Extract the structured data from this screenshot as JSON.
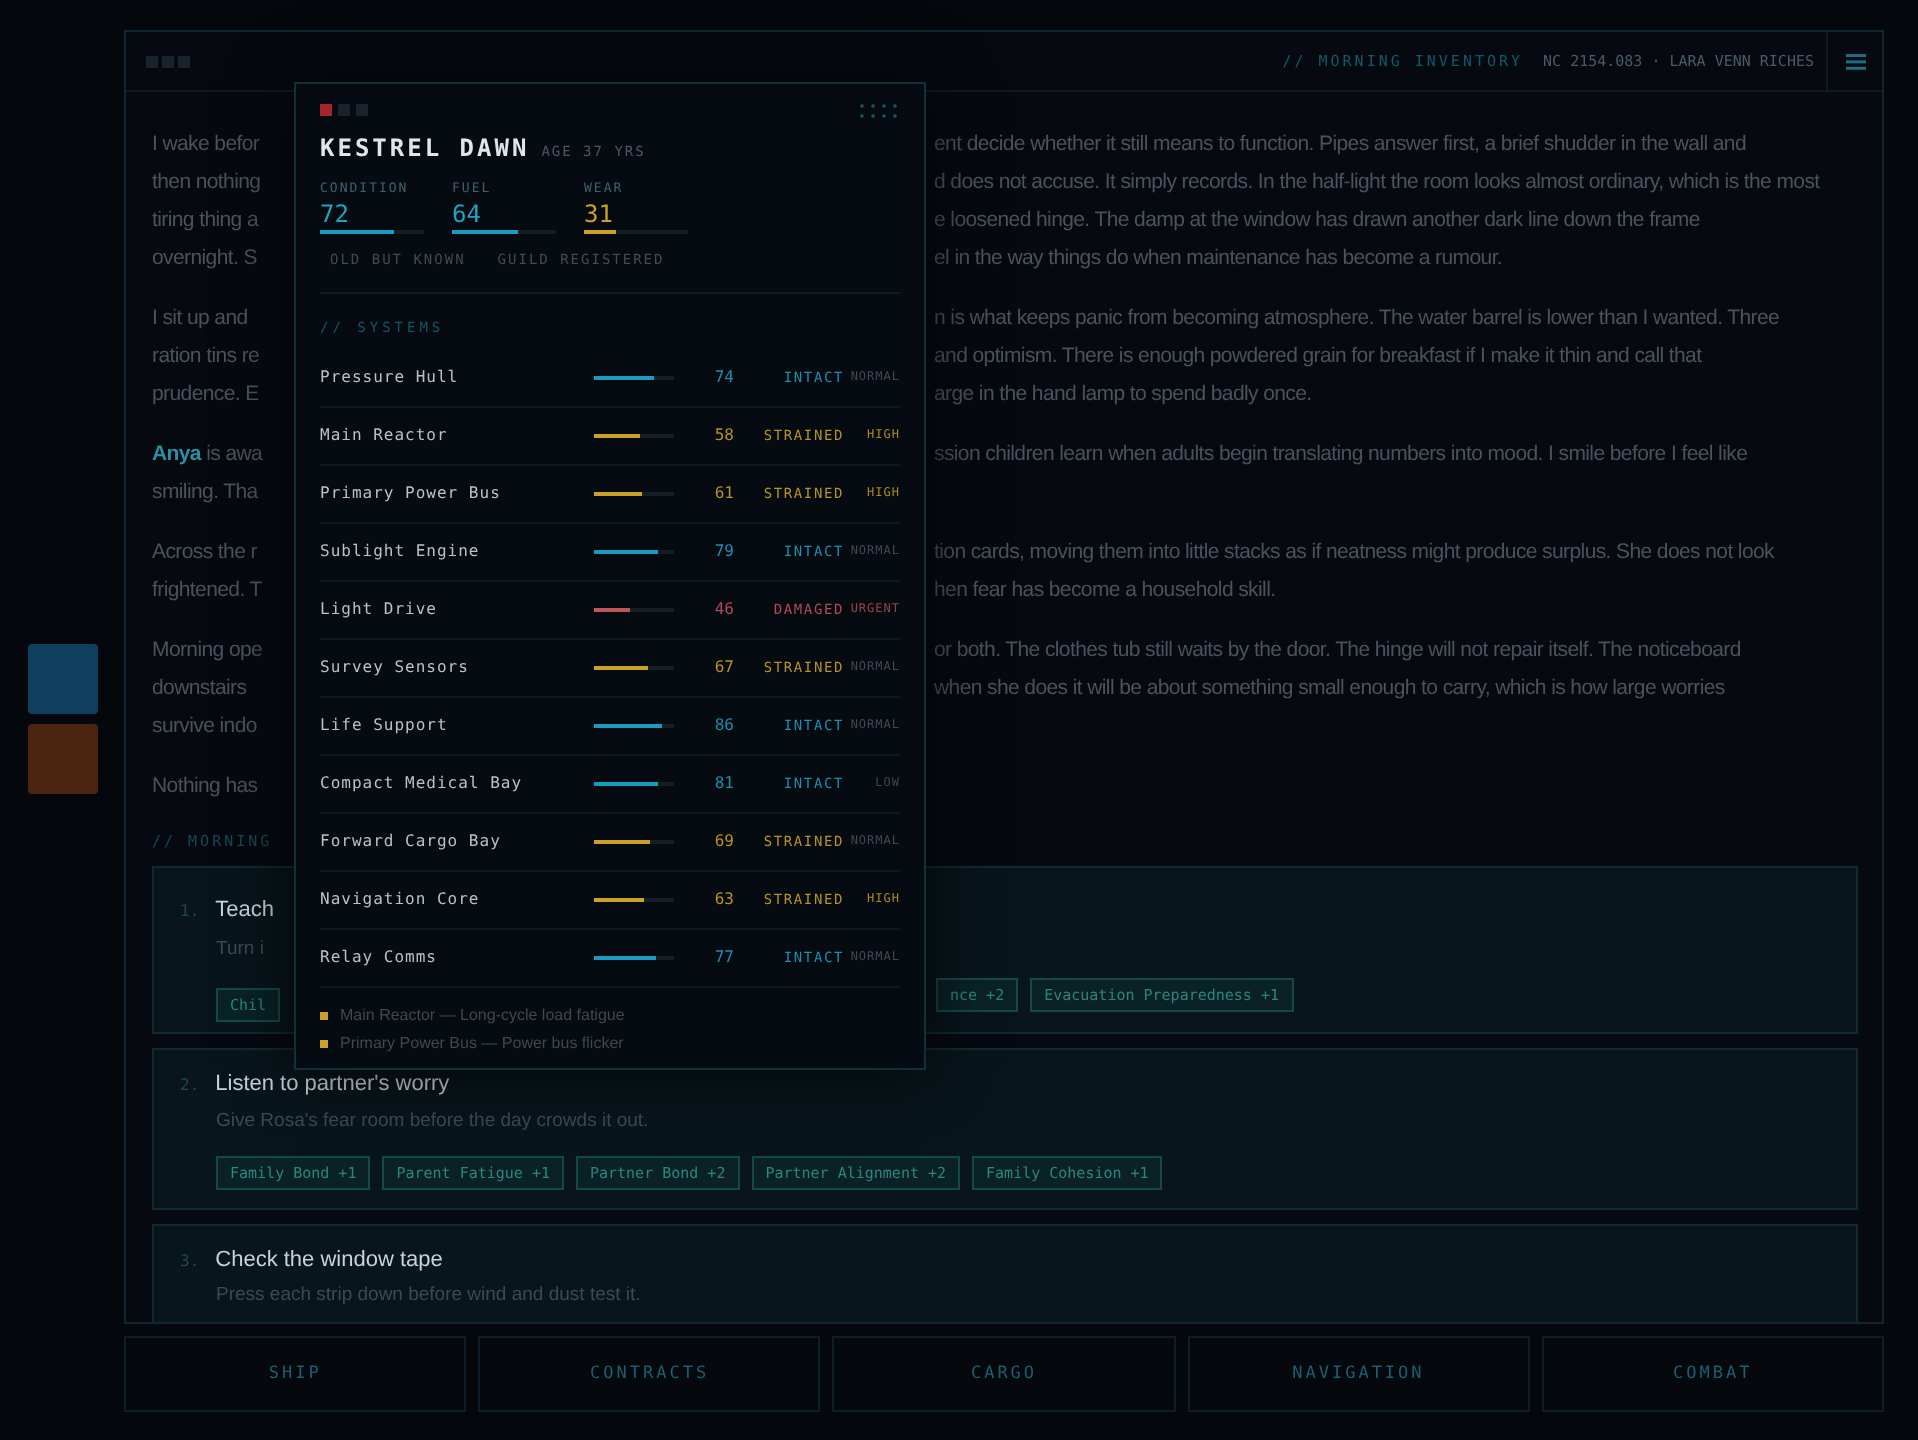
{
  "header": {
    "section": "// MORNING INVENTORY",
    "meta": "NC 2154.083 · LARA VENN RICHES"
  },
  "paragraphs": [
    {
      "lines": [
        {
          "left": "I wake befor",
          "right": "ent decide whether it still means to function. Pipes answer first, a brief shudder in the wall and"
        },
        {
          "left": "then nothing",
          "right": "d does not accuse. It simply records. In the half-light the room looks almost ordinary, which is the most"
        },
        {
          "left": "tiring thing a",
          "right": "e loosened hinge. The damp at the window has drawn another dark line down the frame"
        },
        {
          "left": "overnight. S",
          "right": "el in the way things do when maintenance has become a rumour."
        }
      ]
    },
    {
      "lines": [
        {
          "left": "I sit up and",
          "right": "n is what keeps panic from becoming atmosphere. The water barrel is lower than I wanted. Three"
        },
        {
          "left": "ration tins re",
          "right": "and optimism. There is enough powdered grain for breakfast if I make it thin and call that"
        },
        {
          "left": "prudence. E",
          "right": "arge in the hand lamp to spend badly once."
        }
      ]
    },
    {
      "lines": [
        {
          "highlight": "Anya",
          "left": " is awa",
          "right": "ssion children learn when adults begin translating numbers into mood. I smile before I feel like"
        },
        {
          "left": "smiling. Tha"
        }
      ]
    },
    {
      "lines": [
        {
          "left": "Across the r",
          "right": "tion cards, moving them into little stacks as if neatness might produce surplus. She does not look"
        },
        {
          "left": "frightened. T",
          "right": "hen fear has become a household skill."
        }
      ]
    },
    {
      "lines": [
        {
          "left": "Morning ope",
          "right": "or both. The clothes tub still waits by the door. The hinge will not repair itself. The noticeboard"
        },
        {
          "left": "downstairs",
          "right": "when she does it will be about something small enough to carry, which is how large worries"
        },
        {
          "left": "survive indo"
        }
      ]
    },
    {
      "lines": [
        {
          "left": "Nothing has"
        }
      ]
    }
  ],
  "section_label": "// MORNING",
  "tasks": [
    {
      "kind": "covered",
      "number": "1.",
      "title": "Teach",
      "subtitle": "Turn i",
      "tags_left": [
        "Chil"
      ],
      "tags": [
        "nce +2",
        "Evacuation Preparedness +1"
      ]
    },
    {
      "kind": "full",
      "number": "2.",
      "title": "Listen to partner's worry",
      "subtitle": "Give Rosa's fear room before the day crowds it out.",
      "tags": [
        "Family Bond +1",
        "Parent Fatigue +1",
        "Partner Bond +2",
        "Partner Alignment +2",
        "Family Cohesion +1"
      ]
    },
    {
      "kind": "full",
      "number": "3.",
      "title": "Check the window tape",
      "subtitle": "Press each strip down before wind and dust test it."
    }
  ],
  "nav": [
    "SHIP",
    "CONTRACTS",
    "CARGO",
    "NAVIGATION",
    "COMBAT"
  ],
  "ship": {
    "name": "KESTREL DAWN",
    "age": "AGE 37 YRS",
    "stats": [
      {
        "label": "CONDITION",
        "value": "72",
        "level": 0.72,
        "kind": "nominal"
      },
      {
        "label": "FUEL",
        "value": "64",
        "level": 0.64,
        "kind": "nominal"
      },
      {
        "label": "WEAR",
        "value": "31",
        "level": 0.31,
        "kind": "warning"
      }
    ],
    "tags": [
      "OLD BUT KNOWN",
      "GUILD REGISTERED"
    ],
    "systems_label": "// SYSTEMS",
    "systems": [
      {
        "name": "Pressure Hull",
        "level": 0.74,
        "value": "74",
        "status": "INTACT",
        "kind": "intact",
        "priority": {
          "label": "NORMAL",
          "color": "#3e4a55"
        }
      },
      {
        "name": "Main Reactor",
        "level": 0.58,
        "value": "58",
        "status": "STRAINED",
        "kind": "strained",
        "priority": {
          "label": "HIGH",
          "color": "#a88a25"
        }
      },
      {
        "name": "Primary Power Bus",
        "level": 0.61,
        "value": "61",
        "status": "STRAINED",
        "kind": "strained",
        "priority": {
          "label": "HIGH",
          "color": "#a88a25"
        }
      },
      {
        "name": "Sublight Engine",
        "level": 0.79,
        "value": "79",
        "status": "INTACT",
        "kind": "intact",
        "priority": {
          "label": "NORMAL",
          "color": "#3e4a55"
        }
      },
      {
        "name": "Light Drive",
        "level": 0.46,
        "value": "46",
        "status": "DAMAGED",
        "kind": "damaged",
        "priority": {
          "label": "URGENT",
          "color": "#a0404a"
        }
      },
      {
        "name": "Survey Sensors",
        "level": 0.67,
        "value": "67",
        "status": "STRAINED",
        "kind": "strained",
        "priority": {
          "label": "NORMAL",
          "color": "#3e4a55"
        }
      },
      {
        "name": "Life Support",
        "level": 0.86,
        "value": "86",
        "status": "INTACT",
        "kind": "intact",
        "priority": {
          "label": "NORMAL",
          "color": "#3e4a55"
        }
      },
      {
        "name": "Compact Medical Bay",
        "level": 0.81,
        "value": "81",
        "status": "INTACT",
        "kind": "intact",
        "priority": {
          "label": "LOW",
          "color": "#3a4650"
        }
      },
      {
        "name": "Forward Cargo Bay",
        "level": 0.69,
        "value": "69",
        "status": "STRAINED",
        "kind": "strained",
        "priority": {
          "label": "NORMAL",
          "color": "#3e4a55"
        }
      },
      {
        "name": "Navigation Core",
        "level": 0.63,
        "value": "63",
        "status": "STRAINED",
        "kind": "strained",
        "priority": {
          "label": "HIGH",
          "color": "#a88a25"
        }
      },
      {
        "name": "Relay Comms",
        "level": 0.77,
        "value": "77",
        "status": "INTACT",
        "kind": "intact",
        "priority": {
          "label": "NORMAL",
          "color": "#3e4a55"
        }
      }
    ],
    "notes": [
      "Main Reactor — Long-cycle load fatigue",
      "Primary Power Bus — Power bus flicker"
    ]
  }
}
